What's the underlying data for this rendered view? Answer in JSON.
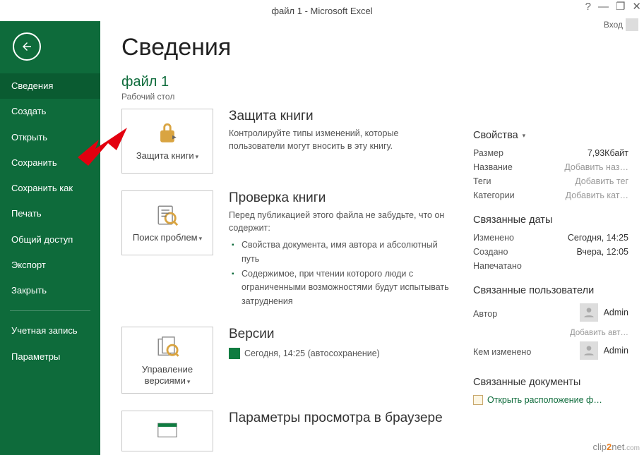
{
  "window": {
    "title": "файл 1 - Microsoft Excel",
    "signin": "Вход"
  },
  "sidebar": {
    "items": [
      {
        "label": "Сведения",
        "active": true
      },
      {
        "label": "Создать"
      },
      {
        "label": "Открыть"
      },
      {
        "label": "Сохранить"
      },
      {
        "label": "Сохранить как"
      },
      {
        "label": "Печать"
      },
      {
        "label": "Общий доступ"
      },
      {
        "label": "Экспорт"
      },
      {
        "label": "Закрыть"
      }
    ],
    "bottom_items": [
      {
        "label": "Учетная запись"
      },
      {
        "label": "Параметры"
      }
    ]
  },
  "page": {
    "heading": "Сведения",
    "file_name": "файл 1",
    "file_path": "Рабочий стол"
  },
  "sections": {
    "protect": {
      "button": "Защита книги",
      "title": "Защита книги",
      "desc": "Контролируйте типы изменений, которые пользователи могут вносить в эту книгу."
    },
    "inspect": {
      "button": "Поиск проблем",
      "title": "Проверка книги",
      "desc": "Перед публикацией этого файла не забудьте, что он содержит:",
      "items": [
        "Свойства документа, имя автора и абсолютный путь",
        "Содержимое, при чтении которого люди с ограниченными возможностями будут испытывать затруднения"
      ]
    },
    "versions": {
      "button": "Управление версиями",
      "title": "Версии",
      "line": "Сегодня, 14:25 (автосохранение)"
    },
    "browser": {
      "title": "Параметры просмотра в браузере"
    }
  },
  "props": {
    "header": "Свойства",
    "rows": [
      {
        "label": "Размер",
        "value": "7,93Кбайт"
      },
      {
        "label": "Название",
        "value": "Добавить наз…",
        "muted": true
      },
      {
        "label": "Теги",
        "value": "Добавить тег",
        "muted": true
      },
      {
        "label": "Категории",
        "value": "Добавить кат…",
        "muted": true
      }
    ],
    "dates_header": "Связанные даты",
    "dates": [
      {
        "label": "Изменено",
        "value": "Сегодня, 14:25"
      },
      {
        "label": "Создано",
        "value": "Вчера, 12:05"
      },
      {
        "label": "Напечатано",
        "value": ""
      }
    ],
    "users_header": "Связанные пользователи",
    "author_label": "Автор",
    "author_value": "Admin",
    "add_author": "Добавить авт…",
    "modified_by_label": "Кем изменено",
    "modified_by_value": "Admin",
    "docs_header": "Связанные документы",
    "open_location": "Открыть расположение ф…"
  },
  "watermark": {
    "a": "clip",
    "b": "2",
    "c": "net",
    "d": ".com"
  }
}
